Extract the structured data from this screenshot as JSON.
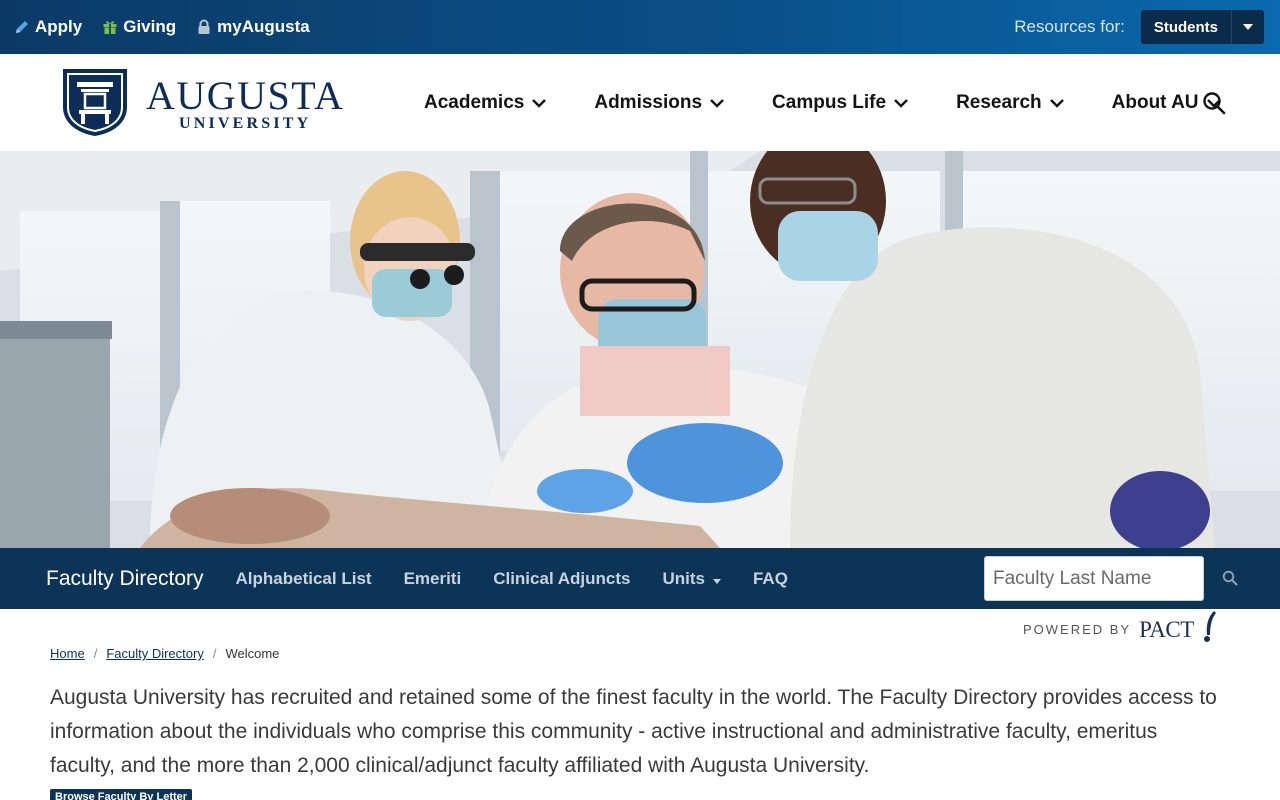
{
  "utility_bar": {
    "links": [
      {
        "label": "Apply",
        "icon": "pencil-icon",
        "icon_color": "#5aa5e6"
      },
      {
        "label": "Giving",
        "icon": "gift-icon",
        "icon_color": "#7bc043"
      },
      {
        "label": "myAugusta",
        "icon": "lock-icon",
        "icon_color": "#b8c4d0"
      }
    ],
    "resources_label": "Resources for:",
    "resources_selected": "Students"
  },
  "header": {
    "logo_word": "AUGUSTA",
    "logo_sub": "UNIVERSITY",
    "nav": [
      {
        "label": "Academics"
      },
      {
        "label": "Admissions"
      },
      {
        "label": "Campus Life"
      },
      {
        "label": "Research"
      },
      {
        "label": "About AU"
      }
    ]
  },
  "sub_nav": {
    "title": "Faculty Directory",
    "links": [
      {
        "label": "Alphabetical List"
      },
      {
        "label": "Emeriti"
      },
      {
        "label": "Clinical Adjuncts"
      },
      {
        "label": "Units"
      },
      {
        "label": "FAQ"
      }
    ],
    "search_placeholder": "Faculty Last Name"
  },
  "powered_by": {
    "label": "POWERED BY",
    "brand": "PACT"
  },
  "breadcrumb": {
    "home": "Home",
    "section": "Faculty Directory",
    "current": "Welcome"
  },
  "intro": "Augusta University has recruited and retained some of the finest faculty in the world. The Faculty Directory provides access to information about the individuals who comprise this community - active instructional and administrative faculty, emeritus faculty, and the more than 2,000 clinical/adjunct faculty affiliated with Augusta University.",
  "browse_badge": "Browse Faculty By Letter",
  "colors": {
    "brand_navy": "#0c3457",
    "topbar_blue": "#0a4f86",
    "logo_navy": "#0b2d57"
  }
}
